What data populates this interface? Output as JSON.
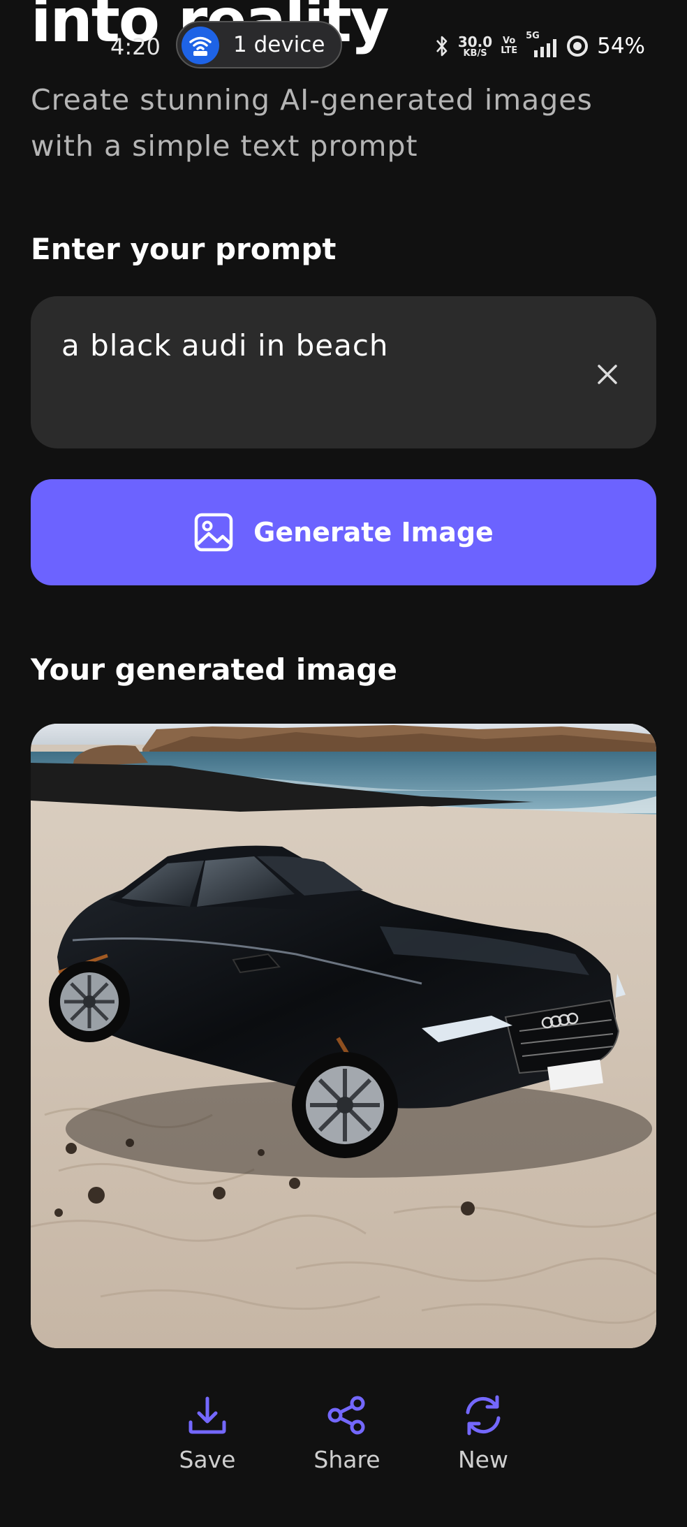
{
  "header": {
    "hero_title": "into reality",
    "subtitle": "Create stunning AI-generated images with a simple text prompt"
  },
  "status_bar": {
    "time": "4:20",
    "hotspot_label": "1 device",
    "speed_value": "30.0",
    "speed_unit": "KB/S",
    "volte_top": "Vo",
    "volte_bottom": "LTE",
    "network_type": "5G",
    "battery": "54%"
  },
  "prompt": {
    "label": "Enter your prompt",
    "value": "a black audi in beach"
  },
  "generate_button": {
    "label": "Generate Image"
  },
  "result": {
    "label": "Your generated image"
  },
  "actions": {
    "save": "Save",
    "share": "Share",
    "new": "New"
  },
  "colors": {
    "background": "#111111",
    "accent": "#6c63ff",
    "input_background": "#2b2b2b",
    "icon_accent": "#7468ff"
  },
  "icons": {
    "clear": "close-icon",
    "generate": "image-icon",
    "save": "download-icon",
    "share": "share-icon",
    "new": "refresh-icon"
  }
}
